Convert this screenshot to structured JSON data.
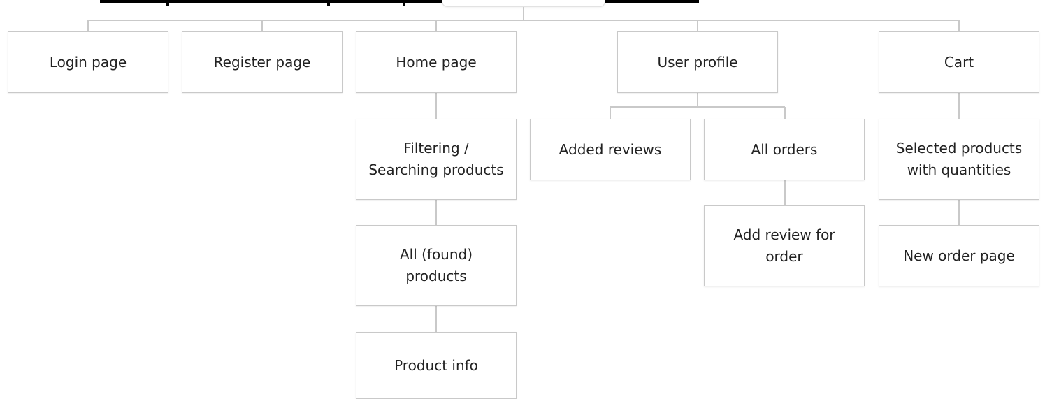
{
  "colors": {
    "node_border": "#c9c9c9",
    "connector": "#c9c9c9",
    "text": "#222222",
    "background": "#ffffff"
  },
  "nodes": {
    "login": "Login page",
    "register": "Register page",
    "home": "Home page",
    "profile": "User profile",
    "cart": "Cart",
    "filtering": "Filtering /\nSearching products",
    "all_products": "All (found)\nproducts",
    "product_info": "Product info",
    "added_reviews": "Added reviews",
    "all_orders": "All orders",
    "add_review": "Add review for\norder",
    "selected_products": "Selected products\nwith quantities",
    "new_order": "New order page"
  }
}
